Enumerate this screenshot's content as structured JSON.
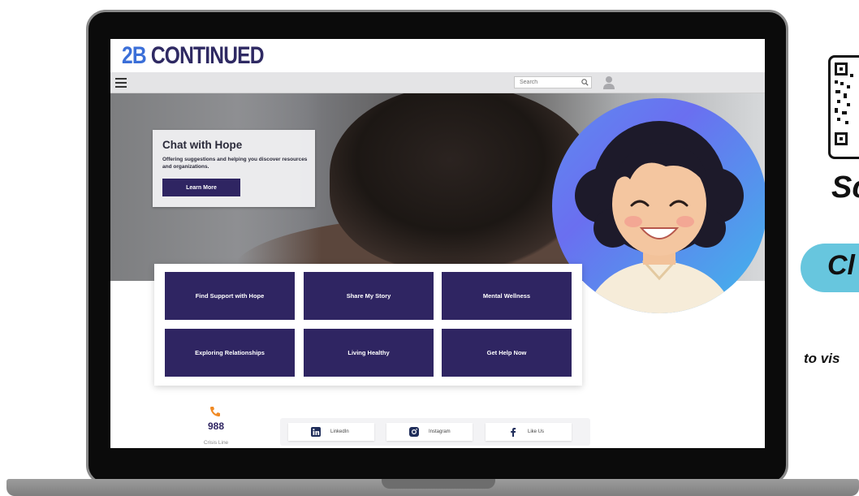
{
  "site": {
    "logo_part1": "2B",
    "logo_part2": "CONTINUED",
    "brand_colors": {
      "blue": "#3b6fd8",
      "navy": "#2f2a63",
      "tile": "#2f2562"
    }
  },
  "navbar": {
    "search_placeholder": "Search"
  },
  "hero": {
    "title": "Chat with Hope",
    "subtitle": "Offering suggestions and helping you discover resources and organizations.",
    "cta_label": "Learn More"
  },
  "tiles": [
    {
      "label": "Find Support with Hope"
    },
    {
      "label": "Share My Story"
    },
    {
      "label": "Mental Wellness"
    },
    {
      "label": "Exploring Relationships"
    },
    {
      "label": "Living Healthy"
    },
    {
      "label": "Get Help Now"
    }
  ],
  "footer": {
    "crisis_number": "988",
    "crisis_label": "Crisis Line",
    "social": [
      {
        "label": "LinkedIn",
        "icon": "linkedin-icon"
      },
      {
        "label": "Instagram",
        "icon": "instagram-icon"
      },
      {
        "label": "Like Us",
        "icon": "facebook-icon"
      }
    ]
  },
  "promo": {
    "scan_fragment": "Sc",
    "click_fragment": "Cl",
    "visit_fragment": "to vis",
    "pill_color": "#67c6de"
  }
}
